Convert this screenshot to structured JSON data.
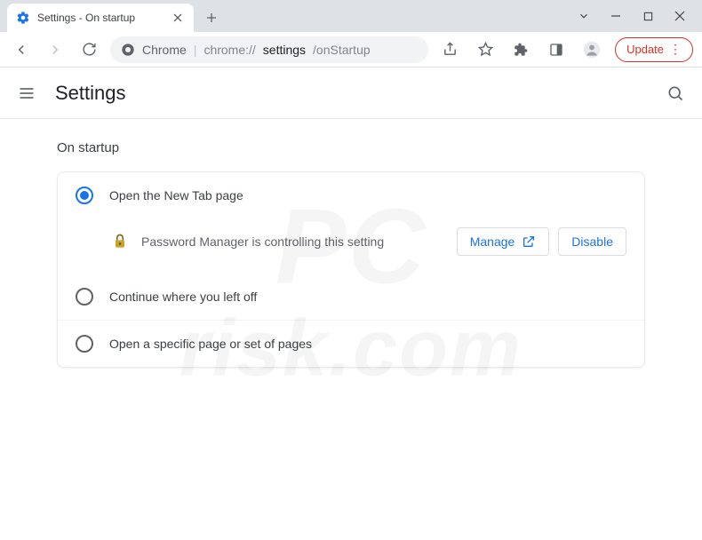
{
  "window": {
    "tab_title": "Settings - On startup"
  },
  "omnibox": {
    "security_label": "Chrome",
    "host": "chrome://",
    "path_strong": "settings",
    "path_rest": "/onStartup"
  },
  "toolbar": {
    "update_label": "Update"
  },
  "settings": {
    "title": "Settings",
    "section_title": "On startup",
    "options": {
      "open_new_tab": "Open the New Tab page",
      "continue": "Continue where you left off",
      "specific": "Open a specific page or set of pages"
    },
    "controlled": {
      "message": "Password Manager is controlling this setting",
      "manage_label": "Manage",
      "disable_label": "Disable"
    }
  },
  "watermark": {
    "line1": "PC",
    "line2": "risk.com"
  }
}
